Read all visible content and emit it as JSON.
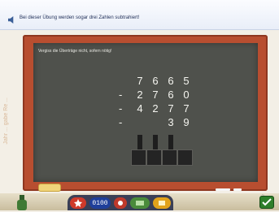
{
  "header": {
    "instruction": "Bei dieser Übung werden sogar drei Zahlen subtrahiert!"
  },
  "board": {
    "hint": "Vergiss die Überträge nicht, sofern nötig!",
    "rows": [
      {
        "op": "",
        "digits": [
          "7",
          "6",
          "6",
          "5"
        ]
      },
      {
        "op": "-",
        "digits": [
          "2",
          "7",
          "6",
          "0"
        ]
      },
      {
        "op": "-",
        "digits": [
          "4",
          "2",
          "7",
          "7"
        ]
      },
      {
        "op": "-",
        "digits": [
          "",
          "",
          "3",
          "9"
        ]
      }
    ]
  },
  "toolbar": {
    "counter": "0100"
  },
  "side_note": "Jahr ... gabe Re ..."
}
